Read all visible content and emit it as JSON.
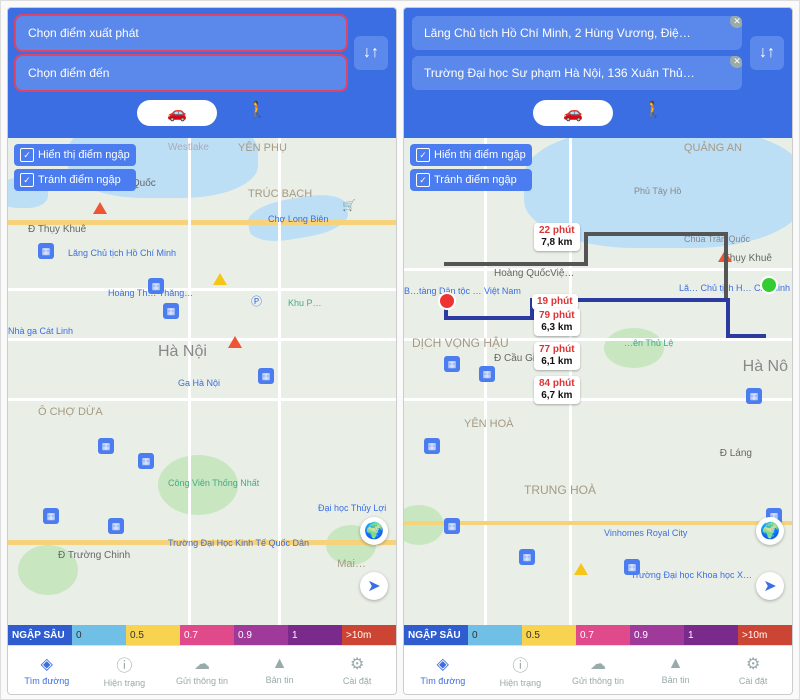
{
  "left": {
    "search": {
      "from": "Chọn điểm xuất phát",
      "to": "Chọn điểm đến",
      "swap": "↓↑"
    },
    "checkboxes": [
      "Hiển thị điểm ngập",
      "Tránh điểm ngập"
    ],
    "labels": {
      "west_lake": "Westlake",
      "yen_phu": "YÊN PHỤ",
      "truc_bach": "TRÚC BẠCH",
      "an_quoc": "an Quốc",
      "cho_long_bien": "Chợ Long Biên",
      "thuy_khue": "Đ Thụy Khuê",
      "lang": "Lăng Chủ tịch Hồ Chí Minh",
      "hoang": "Hoàng Th… Thăng…",
      "nha_ga": "Nhà ga Cát Linh",
      "ga_hn": "Ga Hà Nội",
      "hanoi": "Hà Nội",
      "o_cho_dua": "Ô CHỢ DỪA",
      "cong_vien": "Công Viên Thống Nhất",
      "truong": "Trường Đại Học Kinh Tế Quốc Dân",
      "truong_chinh": "Đ Trường Chinh",
      "thuy_loi": "Đại học Thủy Lợi",
      "mai": "Mai…",
      "khu": "Khu P…"
    }
  },
  "right": {
    "search": {
      "from": "Lăng Chủ tịch Hồ Chí Minh, 2 Hùng Vương, Điệ…",
      "to": "Trường Đại học Sư phạm Hà Nội, 136 Xuân Thủ…",
      "swap": "↓↑"
    },
    "checkboxes": [
      "Hiển thị điểm ngập",
      "Tránh điểm ngập"
    ],
    "routes": [
      {
        "t": "22 phút",
        "d": "7,8 km"
      },
      {
        "t": "19 phút",
        "d": ""
      },
      {
        "t": "79 phút",
        "d": "6,3 km"
      },
      {
        "t": "77 phút",
        "d": "6,1 km"
      },
      {
        "t": "84 phút",
        "d": "6,7 km"
      }
    ],
    "labels": {
      "quang_an": "QUẢNG AN",
      "phu_tay_ho": "Phủ Tây Hồ",
      "chua": "Chùa Trấn Quốc",
      "thuy_khue": "Thụy Khuê",
      "hoang_quoc": "Hoàng QuốcViệ…",
      "bao_tang": "B…tàng Dân tộc … Việt Nam",
      "dich_vong": "DỊCH VỌNG HẬU",
      "cau_giay": "Đ Cầu Giấy",
      "yen_hoa": "YÊN HOÀ",
      "lang_l": "Đ Láng",
      "hanoi": "Hà Nô",
      "lang": "Lă… Chủ tịch H… Chí Minh",
      "thu_le": "…ên Thủ Lệ",
      "trung_hoa": "TRUNG HOÀ",
      "vinhomes": "Vinhomes Royal City",
      "truong": "Trường Đại học Khoa học X…"
    }
  },
  "legend": {
    "title": "NGẬP SÂU",
    "stops": [
      "0",
      "0.5",
      "0.7",
      "0.9",
      "1",
      ">10m"
    ],
    "colors": [
      "#2f5dd0",
      "#6fbfe6",
      "#f7d34f",
      "#e04a8b",
      "#a03a9a",
      "#7a2a8a",
      "#c43"
    ]
  },
  "tabs": [
    {
      "icon": "◈",
      "label": "Tìm đường"
    },
    {
      "icon": "ⓘ",
      "label": "Hiện trạng"
    },
    {
      "icon": "☁",
      "label": "Gửi thông tin"
    },
    {
      "icon": "▲",
      "label": "Bản tin"
    },
    {
      "icon": "⚙",
      "label": "Cài đặt"
    }
  ],
  "mode": {
    "car": "⛍",
    "walk": "🚶"
  }
}
